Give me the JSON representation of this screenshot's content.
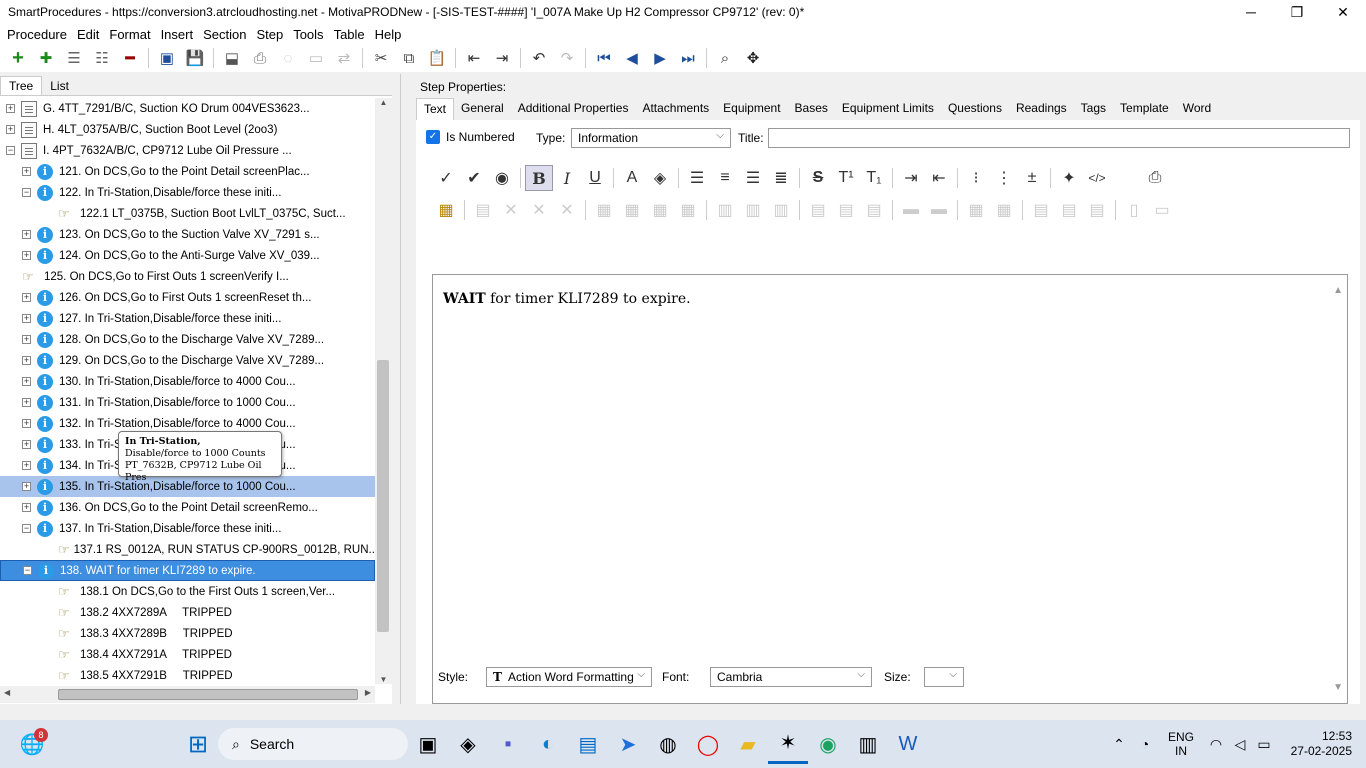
{
  "window": {
    "title": "SmartProcedures - https://conversion3.atrcloudhosting.net - MotivaPRODNew - [-SIS-TEST-####] 'I_007A Make Up H2 Compressor CP9712' (rev: 0)*",
    "minimize": "─",
    "maximize": "❐",
    "close": "✕"
  },
  "menu": [
    "Procedure",
    "Edit",
    "Format",
    "Insert",
    "Section",
    "Step",
    "Tools",
    "Table",
    "Help"
  ],
  "left_tabs": [
    "Tree",
    "List"
  ],
  "tree": [
    {
      "label": "G. 4TT_7291/B/C, Suction KO Drum 004VES3623...",
      "icon": "doc-icon",
      "expand": "+",
      "level": 0
    },
    {
      "label": "H. 4LT_0375A/B/C, Suction Boot Level (2oo3)",
      "icon": "doc-icon",
      "expand": "+",
      "level": 0
    },
    {
      "label": "I. 4PT_7632A/B/C, CP9712 Lube Oil Pressure ...",
      "icon": "doc-icon",
      "expand": "−",
      "level": 0
    },
    {
      "label": "121. On DCS,Go to the Point Detail screenPlac...",
      "icon": "info-icon",
      "expand": "+",
      "level": 1
    },
    {
      "label": "122. In Tri-Station,Disable/force these initi...",
      "icon": "info-icon",
      "expand": "−",
      "level": 1
    },
    {
      "label": "122.1 LT_0375B, Suction Boot LvlLT_0375C, Suct...",
      "icon": "hand-icon",
      "expand": "",
      "level": 2
    },
    {
      "label": "123. On DCS,Go to the Suction Valve XV_7291 s...",
      "icon": "info-icon",
      "expand": "+",
      "level": 1
    },
    {
      "label": "124. On DCS,Go to the Anti-Surge Valve XV_039...",
      "icon": "info-icon",
      "expand": "+",
      "level": 1
    },
    {
      "label": "125. On DCS,Go to First Outs 1 screenVerify I...",
      "icon": "hand-icon",
      "expand": "",
      "level": 1
    },
    {
      "label": "126. On DCS,Go to First Outs 1 screenReset th...",
      "icon": "info-icon",
      "expand": "+",
      "level": 1
    },
    {
      "label": "127. In Tri-Station,Disable/force these initi...",
      "icon": "info-icon",
      "expand": "+",
      "level": 1
    },
    {
      "label": "128. On DCS,Go to the Discharge Valve XV_7289...",
      "icon": "info-icon",
      "expand": "+",
      "level": 1
    },
    {
      "label": "129. On DCS,Go to the Discharge Valve XV_7289...",
      "icon": "info-icon",
      "expand": "+",
      "level": 1
    },
    {
      "label": "130. In Tri-Station,Disable/force to 4000 Cou...",
      "icon": "info-icon",
      "expand": "+",
      "level": 1
    },
    {
      "label": "131. In Tri-Station,Disable/force to 1000 Cou...",
      "icon": "info-icon",
      "expand": "+",
      "level": 1
    },
    {
      "label": "132. In Tri-Station,Disable/force to 4000 Cou...",
      "icon": "info-icon",
      "expand": "+",
      "level": 1
    },
    {
      "label": "133. In Tri-Station,Disable/force to 1000 Cou...",
      "icon": "info-icon",
      "expand": "+",
      "level": 1
    },
    {
      "label": "134. In Tri-Station,Disable/force to 1000 Cou...",
      "icon": "info-icon",
      "expand": "+",
      "level": 1
    },
    {
      "label": "135. In Tri-Station,Disable/force to 1000 Cou...",
      "icon": "info-icon",
      "expand": "+",
      "level": 1,
      "state": "hover"
    },
    {
      "label": "136. On DCS,Go to the Point Detail screenRemo...",
      "icon": "info-icon",
      "expand": "+",
      "level": 1
    },
    {
      "label": "137. In Tri-Station,Disable/force these initi...",
      "icon": "info-icon",
      "expand": "−",
      "level": 1
    },
    {
      "label": "137.1 RS_0012A, RUN STATUS CP-900RS_0012B, RUN...",
      "icon": "hand-icon",
      "expand": "",
      "level": 2
    },
    {
      "label": "138. WAIT for timer KLI7289 to expire.",
      "icon": "info-icon",
      "expand": "−",
      "level": 1,
      "state": "selected"
    },
    {
      "label": "138.1 On DCS,Go to the First Outs 1 screen,Ver...",
      "icon": "hand-icon",
      "expand": "",
      "level": 2
    },
    {
      "label": "138.2 4XX7289A     TRIPPED",
      "icon": "hand-icon",
      "expand": "",
      "level": 2
    },
    {
      "label": "138.3 4XX7289B     TRIPPED",
      "icon": "hand-icon",
      "expand": "",
      "level": 2
    },
    {
      "label": "138.4 4XX7291A     TRIPPED",
      "icon": "hand-icon",
      "expand": "",
      "level": 2
    },
    {
      "label": "138.5 4XX7291B     TRIPPED",
      "icon": "hand-icon",
      "expand": "",
      "level": 2
    }
  ],
  "tooltip": {
    "line1": "In Tri-Station,",
    "line2": "Disable/force to 1000 Counts",
    "line3": "PT_7632B, CP9712 Lube Oil Pres"
  },
  "step_properties": {
    "label": "Step Properties:",
    "tabs": [
      "Text",
      "General",
      "Additional Properties",
      "Attachments",
      "Equipment",
      "Bases",
      "Equipment Limits",
      "Questions",
      "Readings",
      "Tags",
      "Template",
      "Word"
    ],
    "is_numbered_label": "Is Numbered",
    "is_numbered_mark": "✓",
    "type_label": "Type:",
    "type_value": "Information",
    "title_label": "Title:",
    "title_value": "",
    "editor_bold": "WAIT",
    "editor_rest": " for timer KLI7289 to expire.",
    "style_label": "Style:",
    "style_value": "Action Word Formatting",
    "style_icon": "T",
    "font_label": "Font:",
    "font_value": "Cambria",
    "size_label": "Size:",
    "size_value": ""
  },
  "taskbar": {
    "search_label": "Search",
    "lang1": "ENG",
    "lang2": "IN",
    "time": "12:53",
    "date": "27-02-2025",
    "badge": "8"
  }
}
